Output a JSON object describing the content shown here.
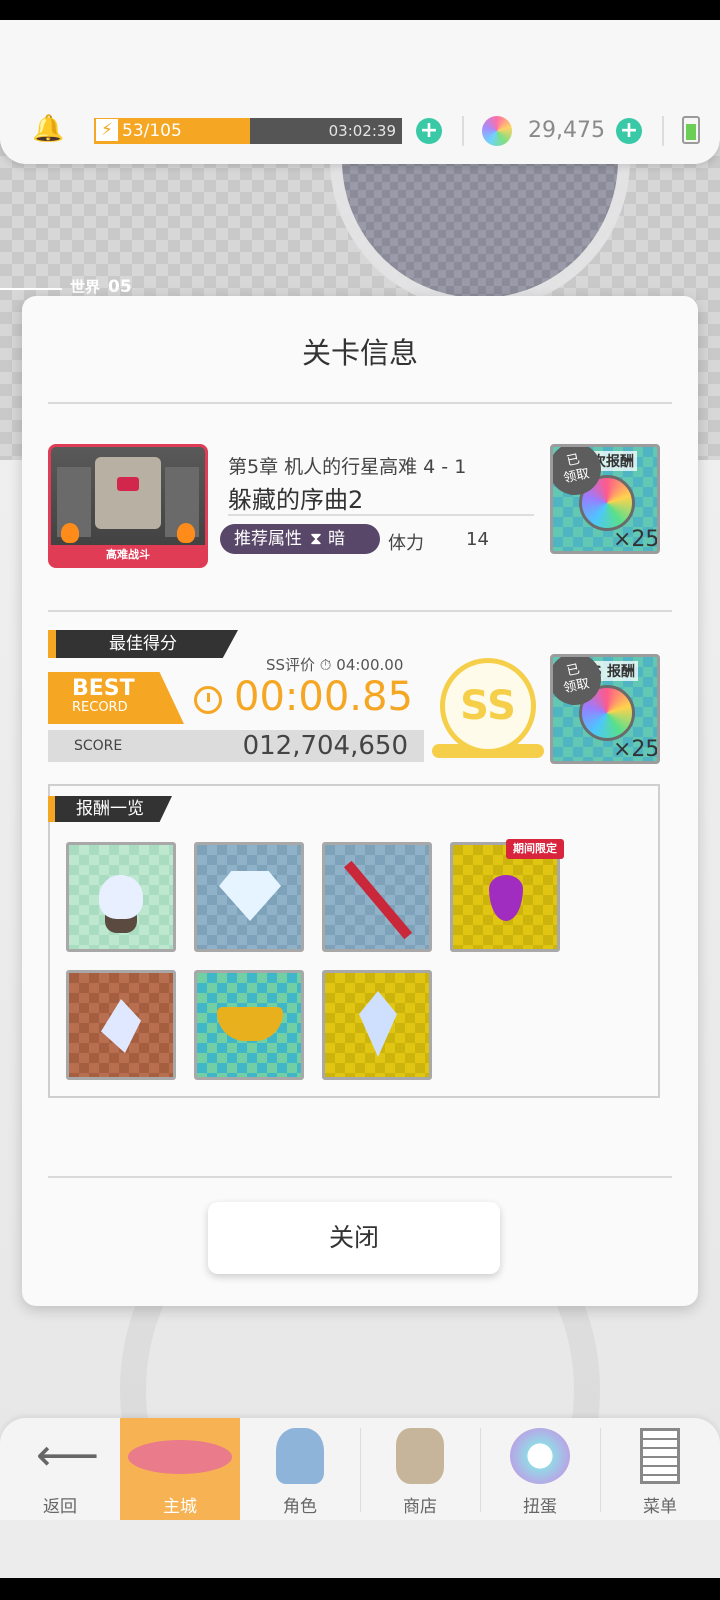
{
  "hud": {
    "stamina": "53/105",
    "stamina_progress": 0.505,
    "timer": "03:02:39",
    "gems": "29,475"
  },
  "background": {
    "world_label": "世界",
    "world_number": "05"
  },
  "dialog": {
    "title": "关卡信息",
    "stage": {
      "thumbnail_label": "高难战斗",
      "chapter": "第5章 机人的行星高难 4 - 1",
      "name": "躲藏的序曲2",
      "attribute_label": "推荐属性",
      "attribute_value": "暗",
      "stamina_label": "体力",
      "stamina_value": "14"
    },
    "first_reward": {
      "title": "次报酬",
      "claimed": "已\n领取",
      "quantity": "×25"
    },
    "best": {
      "section_label": "最佳得分",
      "badge_big": "BEST",
      "badge_small": "RECORD",
      "ss_eval": "SS评价 ⏱ 04:00.00",
      "time": "00:00.85",
      "score_label": "SCORE",
      "score_value": "012,704,650",
      "rank": "SS"
    },
    "ss_reward": {
      "title": "S 报酬",
      "claimed": "已\n领取",
      "quantity": "×25"
    },
    "rewards": {
      "section_label": "报酬一览",
      "limited_label": "期间限定"
    },
    "close_label": "关闭"
  },
  "nav": {
    "back": "返回",
    "home": "主城",
    "characters": "角色",
    "shop": "商店",
    "gacha": "扭蛋",
    "menu": "菜单"
  }
}
